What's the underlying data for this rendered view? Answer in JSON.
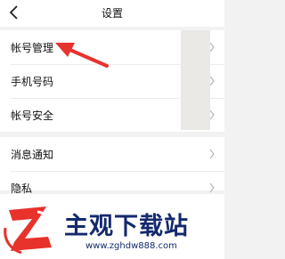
{
  "header": {
    "title": "设置",
    "back_icon": "chevron-left-icon"
  },
  "settings_group_1": {
    "items": [
      {
        "label": "帐号管理",
        "icon": "chevron-right-icon"
      },
      {
        "label": "手机号码",
        "icon": "chevron-right-icon"
      },
      {
        "label": "帐号安全",
        "icon": "chevron-right-icon"
      }
    ]
  },
  "settings_group_2": {
    "items": [
      {
        "label": "消息通知",
        "icon": "chevron-right-icon"
      },
      {
        "label": "隐私",
        "icon": "chevron-right-icon"
      }
    ]
  },
  "annotation": {
    "icon": "red-arrow-icon",
    "color": "#e8322c"
  },
  "watermark": {
    "title": "主观下载站",
    "url": "www.zghdw888.com",
    "logo_icon": "z-logo-icon",
    "logo_color": "#e8322c",
    "text_color": "#14296e"
  }
}
